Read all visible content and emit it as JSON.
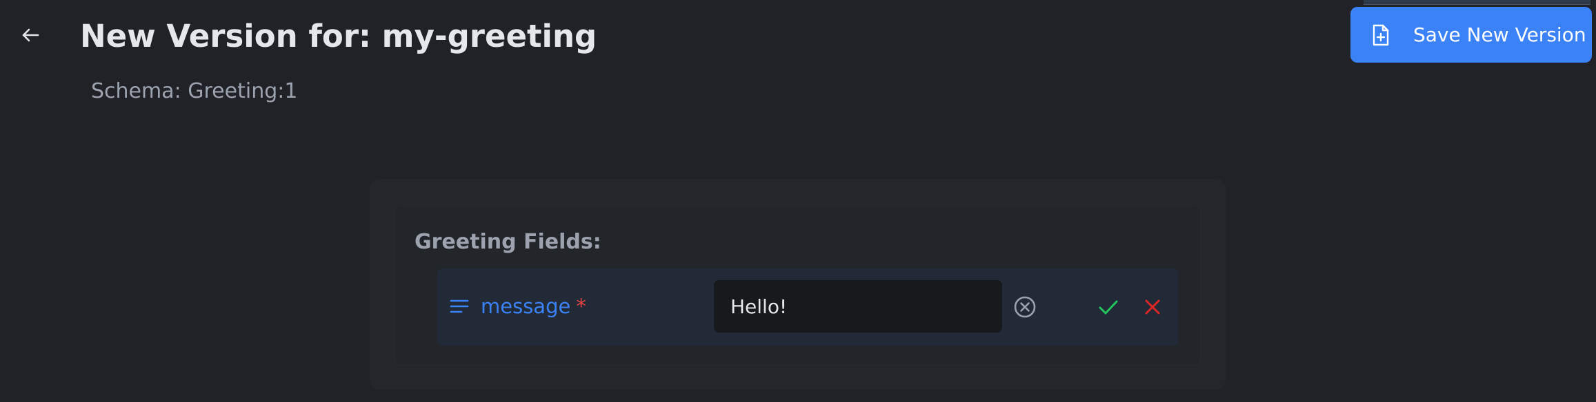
{
  "header": {
    "title": "New Version for: my-greeting",
    "subtitle": "Schema: Greeting:1",
    "back_icon": "arrow-left-icon"
  },
  "toolbar": {
    "save_label": "Save New Version",
    "save_icon": "file-plus-icon"
  },
  "form": {
    "section_title": "Greeting Fields:",
    "fields": [
      {
        "label": "message",
        "required_marker": "*",
        "type_icon": "text-lines-icon",
        "value": "Hello!",
        "clear_icon": "clear-circle-icon",
        "confirm_icon": "check-icon",
        "cancel_icon": "close-icon"
      }
    ]
  },
  "colors": {
    "background": "#202227",
    "accent": "#3b82f6",
    "required": "#ef4444",
    "confirm": "#22c55e",
    "cancel": "#dc2626",
    "field_row": "#222a38",
    "input_bg": "#18191c"
  }
}
